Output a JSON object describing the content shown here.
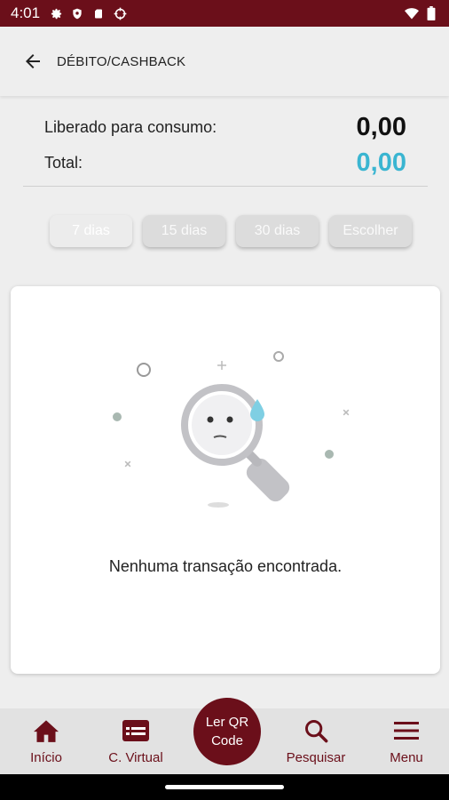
{
  "status_bar": {
    "time": "4:01",
    "left_icons": [
      "gear-icon",
      "shield-icon",
      "sd-card-icon",
      "crosshair-icon"
    ],
    "right_icons": [
      "wifi-icon",
      "battery-icon"
    ]
  },
  "app_bar": {
    "title": "DÉBITO/CASHBACK",
    "back_icon": "arrow-left-icon"
  },
  "summary": {
    "liberado_label": "Liberado para consumo:",
    "liberado_value": "0,00",
    "total_label": "Total:",
    "total_value": "0,00",
    "accent_color": "#3ab5d1"
  },
  "filters": {
    "items": [
      {
        "label": "7 dias",
        "active": true
      },
      {
        "label": "15 dias",
        "active": false
      },
      {
        "label": "30 dias",
        "active": false
      },
      {
        "label": "Escolher",
        "active": false
      }
    ]
  },
  "empty_state": {
    "illustration_icon": "magnifier-sad-icon",
    "message": "Nenhuma transação encontrada."
  },
  "bottom_nav": {
    "brand_color": "#6b0f1a",
    "items": [
      {
        "label": "Início",
        "icon": "home-icon"
      },
      {
        "label": "C. Virtual",
        "icon": "card-icon"
      },
      {
        "label": "Pesquisar",
        "icon": "search-icon"
      },
      {
        "label": "Menu",
        "icon": "menu-icon"
      }
    ],
    "qr_line1": "Ler QR",
    "qr_line2": "Code"
  }
}
